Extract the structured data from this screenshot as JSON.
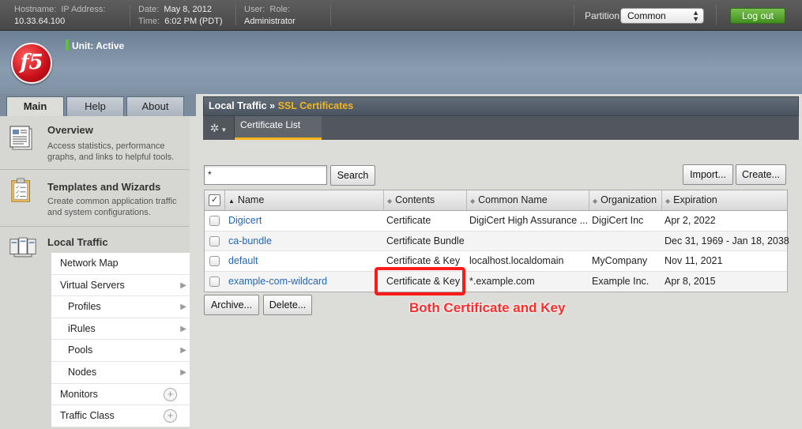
{
  "topbar": {
    "hostname_label": "Hostname:",
    "hostname_value": "10.33.64.100",
    "ip_label": "IP Address:",
    "date_label": "Date:",
    "date_value": "May 8, 2012",
    "time_label": "Time:",
    "time_value": "6:02 PM (PDT)",
    "user_label": "User:",
    "role_label": "Role:",
    "role_value": "Administrator",
    "partition_label": "Partition:",
    "partition_value": "Common",
    "logout_label": "Log out"
  },
  "banner": {
    "logo_text": "f5",
    "unit_status": "Unit: Active"
  },
  "tabs": [
    "Main",
    "Help",
    "About"
  ],
  "sidebar": {
    "overview": {
      "title": "Overview",
      "desc": "Access statistics, performance graphs, and links to helpful tools."
    },
    "templates": {
      "title": "Templates and Wizards",
      "desc": "Create common application traffic and system configurations."
    },
    "local_traffic": {
      "title": "Local Traffic"
    },
    "items": [
      "Network Map",
      "Virtual Servers",
      "Profiles",
      "iRules",
      "Pools",
      "Nodes",
      "Monitors",
      "Traffic Class"
    ]
  },
  "breadcrumb": {
    "section": "Local Traffic",
    "separator": "»",
    "current": "SSL Certificates"
  },
  "subtab": "Certificate List",
  "search": {
    "value": "*",
    "button": "Search"
  },
  "actions": {
    "import": "Import...",
    "create": "Create...",
    "archive": "Archive...",
    "delete": "Delete..."
  },
  "table": {
    "columns": [
      "Name",
      "Contents",
      "Common Name",
      "Organization",
      "Expiration"
    ],
    "rows": [
      {
        "name": "Digicert",
        "contents": "Certificate",
        "common_name": "DigiCert High Assurance ...",
        "organization": "DigiCert Inc",
        "expiration": "Apr 2, 2022"
      },
      {
        "name": "ca-bundle",
        "contents": "Certificate Bundle",
        "common_name": "",
        "organization": "",
        "expiration": "Dec 31, 1969 - Jan 18, 2038"
      },
      {
        "name": "default",
        "contents": "Certificate & Key",
        "common_name": "localhost.localdomain",
        "organization": "MyCompany",
        "expiration": "Nov 11, 2021"
      },
      {
        "name": "example-com-wildcard",
        "contents": "Certificate & Key",
        "common_name": "*.example.com",
        "organization": "Example Inc.",
        "expiration": "Apr 8, 2015"
      }
    ]
  },
  "annotation": "Both Certificate and Key",
  "colors": {
    "accent": "#f3b51c",
    "link": "#2366b7",
    "annotation": "#ff1a1a",
    "logout": "#4fa52b"
  }
}
